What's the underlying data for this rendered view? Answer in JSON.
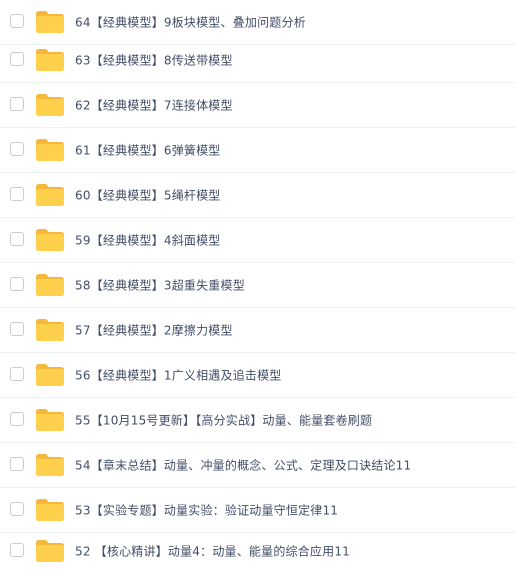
{
  "file_list": {
    "items": [
      {
        "name": "64【经典模型】9板块模型、叠加问题分析"
      },
      {
        "name": "63【经典模型】8传送带模型"
      },
      {
        "name": "62【经典模型】7连接体模型"
      },
      {
        "name": "61【经典模型】6弹簧模型"
      },
      {
        "name": "60【经典模型】5绳杆模型"
      },
      {
        "name": "59【经典模型】4斜面模型"
      },
      {
        "name": "58【经典模型】3超重失重模型"
      },
      {
        "name": "57【经典模型】2摩擦力模型"
      },
      {
        "name": "56【经典模型】1广义相遇及追击模型"
      },
      {
        "name": "55【10月15号更新】【高分实战】动量、能量套卷刷题"
      },
      {
        "name": "54【章末总结】动量、冲量的概念、公式、定理及口诀结论11"
      },
      {
        "name": "53【实验专题】动量实验：验证动量守恒定律11"
      },
      {
        "name": "52 【核心精讲】动量4：动量、能量的综合应用11"
      }
    ]
  },
  "colors": {
    "folder_body": "#ffd04b",
    "folder_tab": "#f5b83a",
    "text": "#424e67",
    "checkbox_border": "#c8ccd3",
    "divider": "#f1f2f4"
  },
  "icons": {
    "row_icon": "folder-icon",
    "row_selector": "checkbox"
  }
}
